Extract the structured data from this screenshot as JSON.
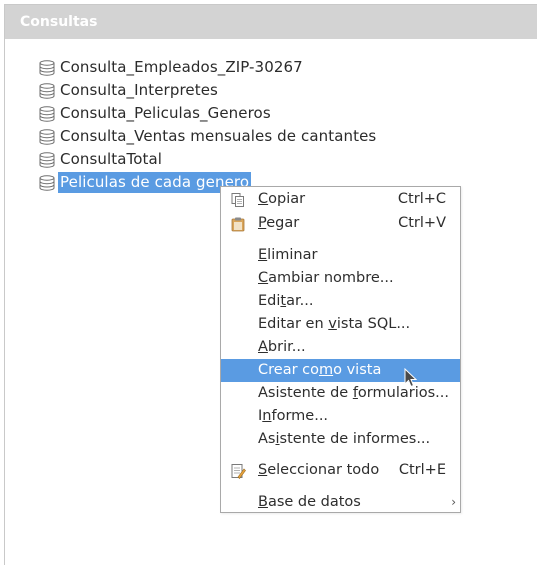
{
  "panel": {
    "title": "Consultas"
  },
  "tree": {
    "items": [
      {
        "label": "Consulta_Empleados_ZIP-30267",
        "icon": "database-icon"
      },
      {
        "label": "Consulta_Interpretes",
        "icon": "database-icon"
      },
      {
        "label": "Consulta_Peliculas_Generos",
        "icon": "database-icon"
      },
      {
        "label": "Consulta_Ventas mensuales de cantantes",
        "icon": "database-icon"
      },
      {
        "label": "ConsultaTotal",
        "icon": "database-icon"
      },
      {
        "label": "Peliculas de cada genero",
        "icon": "database-icon",
        "selected": true
      }
    ]
  },
  "context_menu": {
    "items": [
      {
        "label": "Copiar",
        "shortcut": "Ctrl+C",
        "icon": "copy-icon",
        "mnemonic": "C"
      },
      {
        "label": "Pegar",
        "shortcut": "Ctrl+V",
        "icon": "paste-icon",
        "mnemonic": "P"
      },
      {
        "label": "Eliminar",
        "mnemonic": "E"
      },
      {
        "label": "Cambiar nombre...",
        "mnemonic": "C"
      },
      {
        "label": "Editar...",
        "mnemonic": "t"
      },
      {
        "label": "Editar en vista SQL...",
        "mnemonic": "v"
      },
      {
        "label": "Abrir...",
        "mnemonic": "A"
      },
      {
        "label": "Crear como vista",
        "mnemonic": "m",
        "highlighted": true
      },
      {
        "label": "Asistente de formularios...",
        "mnemonic": "f"
      },
      {
        "label": "Informe...",
        "mnemonic": "n"
      },
      {
        "label": "Asistente de informes...",
        "mnemonic": "i"
      },
      {
        "label": "Seleccionar todo",
        "shortcut": "Ctrl+E",
        "icon": "select-all-icon",
        "mnemonic": "S"
      },
      {
        "label": "Base de datos",
        "submenu": true,
        "mnemonic": "B"
      }
    ]
  },
  "colors": {
    "selection": "#5a9be2",
    "header_bg": "#d3d3d3"
  }
}
